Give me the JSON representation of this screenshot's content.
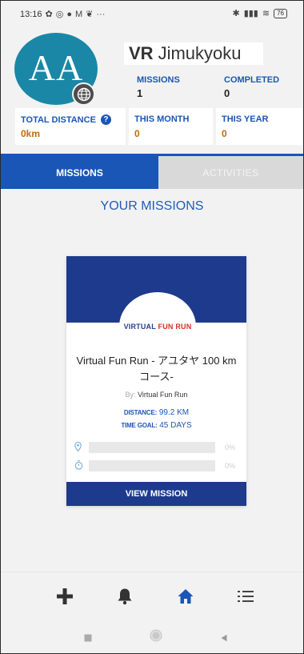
{
  "status_bar": {
    "time": "13:16",
    "left_icons": [
      "✿",
      "◎",
      "●",
      "M",
      "❦",
      "···"
    ],
    "right_icons": [
      "✱",
      "▮▮▮",
      "≋"
    ],
    "battery": "76"
  },
  "profile": {
    "initials": "AA",
    "name_bold": "VR",
    "name_rest": "Jimukyoku",
    "missions_label": "MISSIONS",
    "missions_value": "1",
    "completed_label": "COMPLETED",
    "completed_value": "0"
  },
  "stats": {
    "total_distance_label": "TOTAL DISTANCE",
    "total_distance_value": "0km",
    "this_month_label": "THIS MONTH",
    "this_month_value": "0",
    "this_year_label": "THIS YEAR",
    "this_year_value": "0"
  },
  "tabs": {
    "missions": "MISSIONS",
    "activities": "ACTIVITIES"
  },
  "section_title": "YOUR MISSIONS",
  "mission_card": {
    "logo_main_a": "VIRTUAL",
    "logo_main_b": "FUN RUN",
    "title": "Virtual Fun Run - アユタヤ 100 km コース-",
    "by_label": "By:",
    "by_value": "Virtual Fun Run",
    "distance_label": "DISTANCE:",
    "distance_value": "99.2 KM",
    "time_goal_label": "TIME GOAL:",
    "time_goal_value": "45 DAYS",
    "distance_progress_pct": "0%",
    "time_progress_pct": "0%",
    "distance_progress": 0,
    "time_progress": 0,
    "view_button": "VIEW MISSION"
  },
  "colors": {
    "accent": "#1a56b5",
    "navy": "#1e3a8c",
    "avatar": "#1a87a6",
    "orange_value": "#c06a10"
  },
  "bottom_nav": {
    "icons": [
      "plus-icon",
      "bell-icon",
      "home-icon",
      "menu-icon"
    ]
  }
}
